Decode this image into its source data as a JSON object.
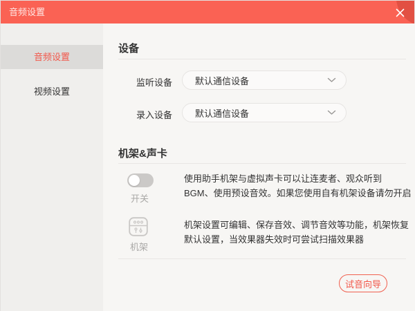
{
  "window": {
    "title": "音频设置"
  },
  "colors": {
    "header_bg": "#fa6254",
    "header_corner": "#e25043",
    "accent_red": "#f2574a",
    "sidebar_bg": "#f0efed",
    "sidebar_selected_bg": "#dcdbd9",
    "main_bg": "#f7f6f4",
    "text_dark": "#333333",
    "text_gray": "#a9a8a6",
    "divider": "#e8e6e4",
    "toggle_off": "#cbc9c7"
  },
  "sidebar": {
    "items": [
      {
        "label": "音频设置",
        "selected": true
      },
      {
        "label": "视频设置",
        "selected": false
      }
    ]
  },
  "device_section": {
    "title": "设备",
    "rows": [
      {
        "label": "监听设备",
        "value": "默认通信设备"
      },
      {
        "label": "录入设备",
        "value": "默认通信设备"
      }
    ]
  },
  "rack_section": {
    "title": "机架&声卡",
    "toggle": {
      "label": "开关",
      "state": "off",
      "description": "使用助手机架与虚拟声卡可以让连麦者、观众听到 BGM、使用预设音效。如果您使用自有机架设备请勿开启"
    },
    "rack": {
      "label": "机架",
      "description": "机架设置可编辑、保存音效、调节音效等功能，机架恢复默认设置，当效果器失效时可尝试扫描效果器"
    }
  },
  "footer": {
    "wizard_button": "试音向导"
  },
  "icons": {
    "close": "close-x",
    "chevron": "chevron-down",
    "rack": "rack-sliders"
  }
}
